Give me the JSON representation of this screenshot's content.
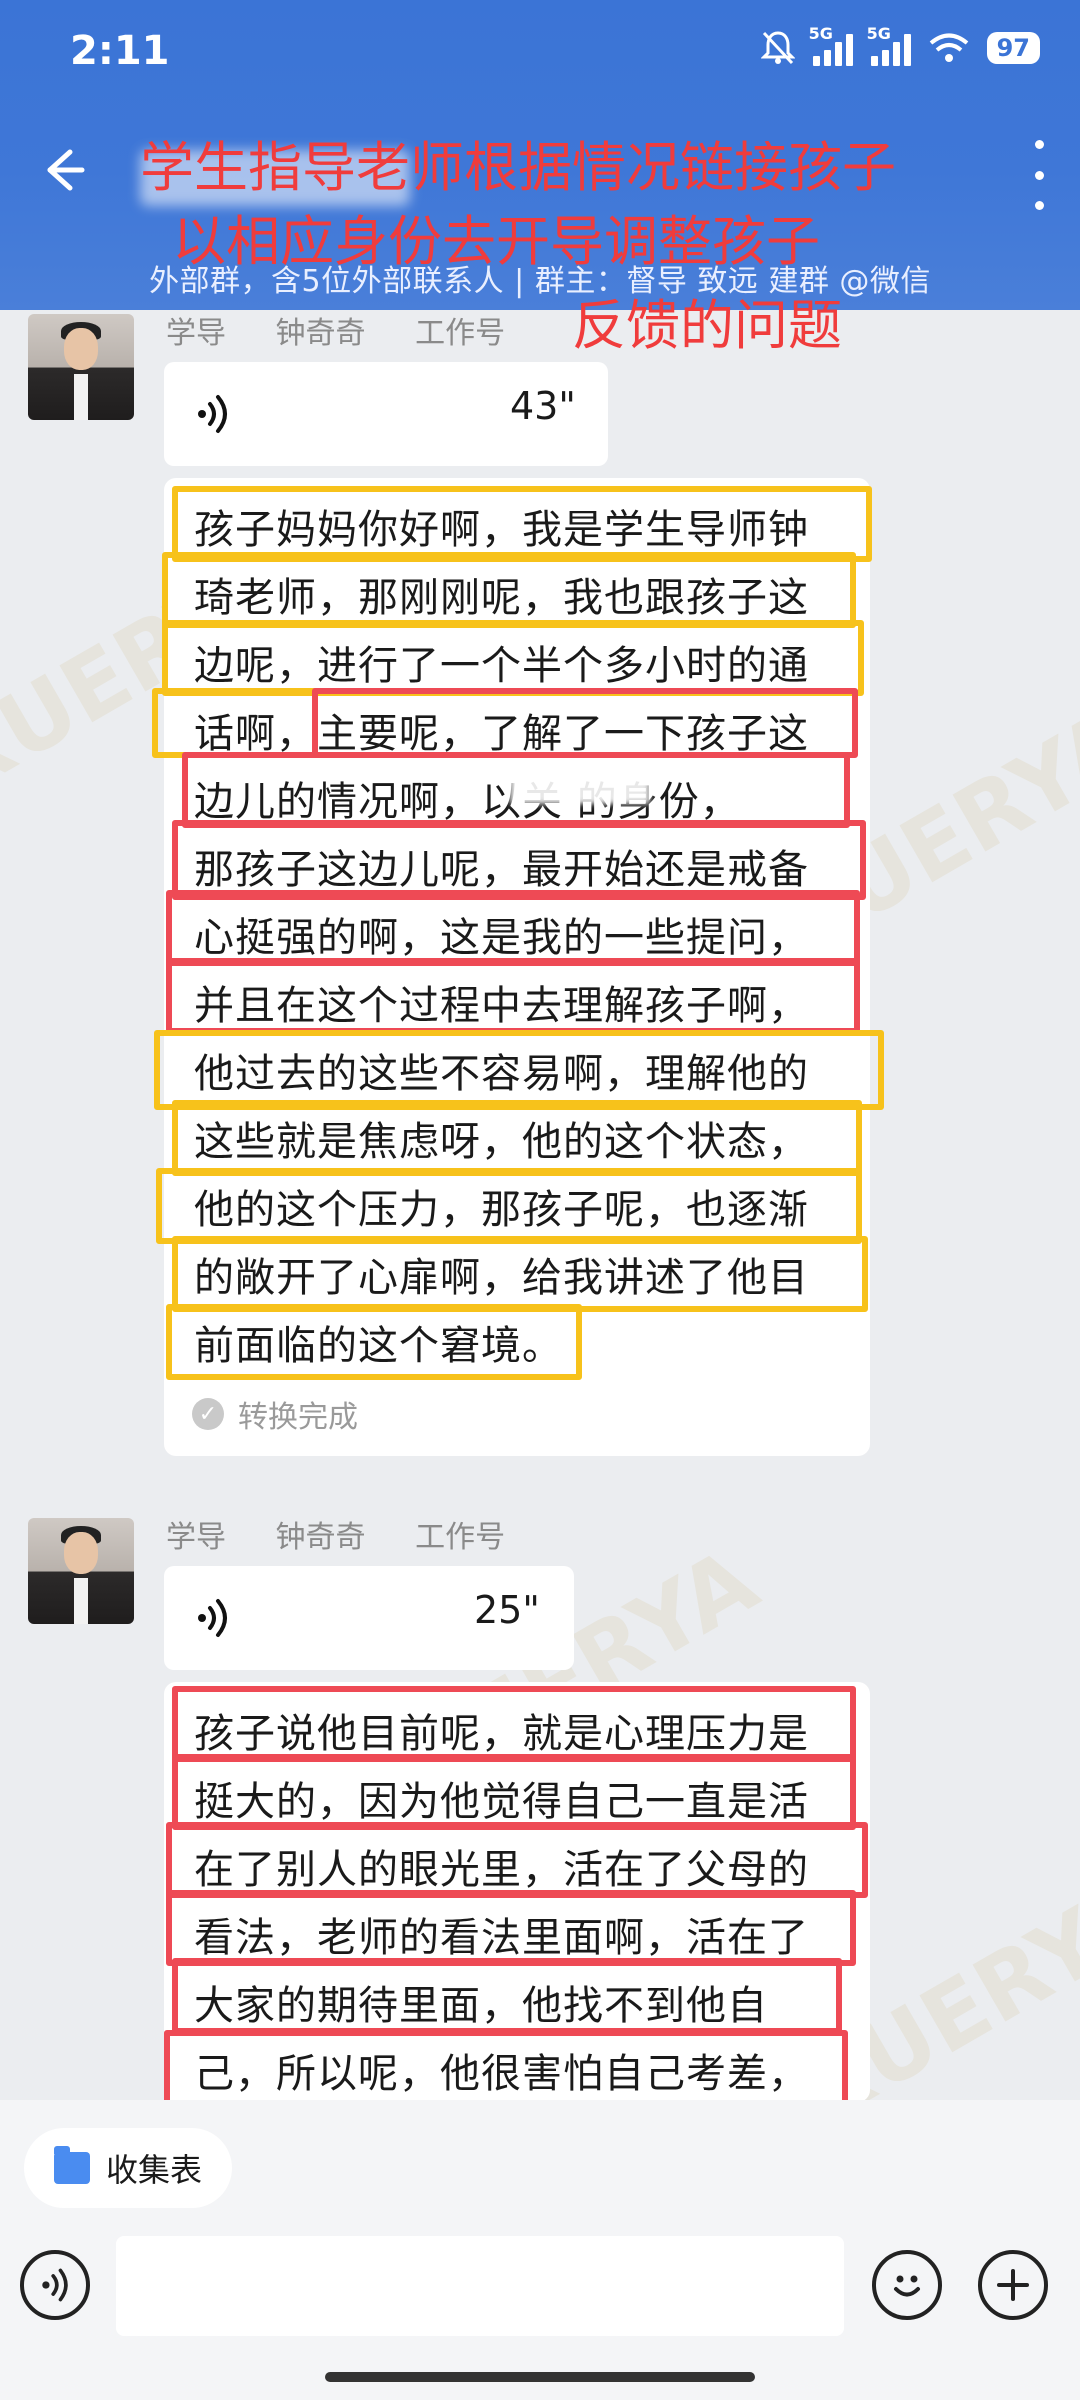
{
  "status_bar": {
    "time": "2:11",
    "net1": "5G",
    "net2": "5G",
    "battery": "97"
  },
  "header": {
    "subtitle": "外部群，含5位外部联系人 | 群主：督导  致远     建群 @微信"
  },
  "overlay_caption": {
    "line1": "学生指导老师根据情况链接孩子",
    "line2": "以相应身份去开导调整孩子",
    "line3": "反馈的问题"
  },
  "messages": [
    {
      "sender_role": "学导",
      "sender_name": "钟奇奇",
      "sender_tag": "工作号",
      "voice_duration": "43\"",
      "lines": [
        "孩子妈妈你好啊，我是学生导师钟",
        "琦老师，那刚刚呢，我也跟孩子这",
        "边呢，进行了一个半个多小时的通",
        "话啊，主要呢，了解了一下孩子这",
        "边儿的情况啊，以关         的身份，",
        "那孩子这边儿呢，最开始还是戒备",
        "心挺强的啊，这是我的一些提问，",
        "并且在这个过程中去理解孩子啊，",
        "他过去的这些不容易啊，理解他的",
        "这些就是焦虑呀，他的这个状态，",
        "他的这个压力，那孩子呢，也逐渐",
        "的敞开了心扉啊，给我讲述了他目",
        "前面临的这个窘境。"
      ],
      "convert_status": "转换完成"
    },
    {
      "sender_role": "学导",
      "sender_name": "钟奇奇",
      "sender_tag": "工作号",
      "voice_duration": "25\"",
      "lines": [
        "孩子说他目前呢，就是心理压力是",
        "挺大的，因为他觉得自己一直是活",
        "在了别人的眼光里，活在了父母的",
        "看法，老师的看法里面啊，活在了",
        "大家的期待里面，他找不到他自",
        "己，所以呢，他很害怕自己考差，"
      ]
    }
  ],
  "bottom": {
    "chip_label": "收集表",
    "input_placeholder": ""
  },
  "colors": {
    "header_blue": "#3b74d6",
    "highlight_yellow": "#f7c21b",
    "highlight_red": "#ee4a55",
    "caption_red": "#f03c3c"
  }
}
